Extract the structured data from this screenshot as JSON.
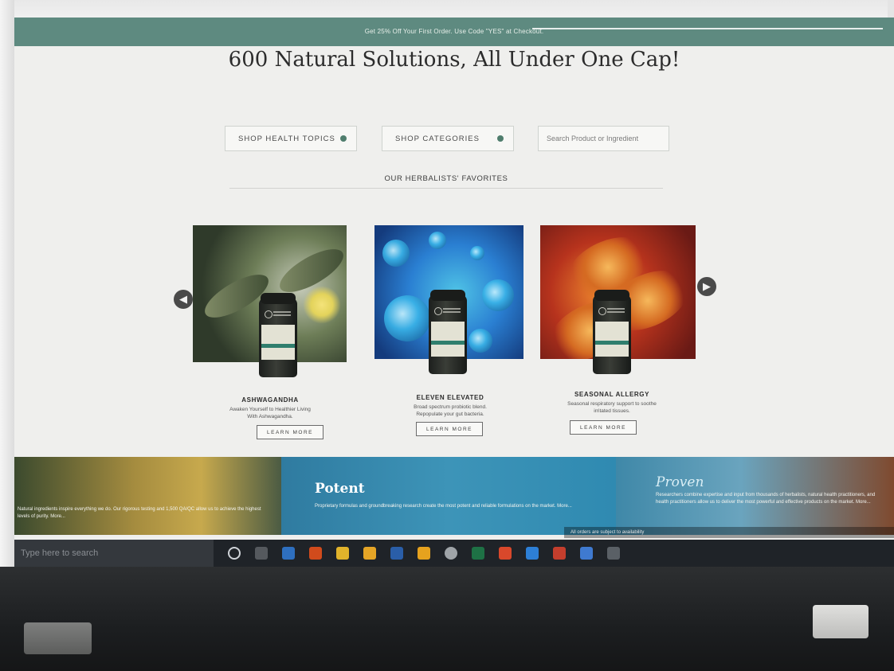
{
  "promo": {
    "text": "Get 25% Off Your First Order. Use Code \"YES\" at Checkout."
  },
  "headline": "600 Natural Solutions, All Under One Cap!",
  "nav": {
    "health_topics": "SHOP HEALTH TOPICS",
    "categories": "SHOP CATEGORIES",
    "search_placeholder": "Search Product or Ingredient"
  },
  "favorites": {
    "title": "OUR HERBALISTS' FAVORITES",
    "products": [
      {
        "name": "ASHWAGANDHA",
        "desc_line1": "Awaken Yourself to Healthier Living",
        "desc_line2": "With Ashwagandha.",
        "button": "LEARN MORE"
      },
      {
        "name": "ELEVEN ELEVATED",
        "desc_line1": "Broad spectrum probiotic blend.",
        "desc_line2": "Repopulate your gut bacteria.",
        "button": "LEARN MORE"
      },
      {
        "name": "SEASONAL ALLERGY",
        "desc_line1": "Seasonal respiratory support to soothe",
        "desc_line2": "irritated tissues.",
        "button": "LEARN MORE"
      }
    ]
  },
  "strips": {
    "left_text": "Natural ingredients inspire everything we do. Our rigorous testing and 1,500 QA/QC allow us to achieve the highest levels of purity. More...",
    "mid_title": "Potent",
    "mid_text": "Proprietary formulas and groundbreaking research create the most potent and reliable formulations on the market. More...",
    "right_title": "Proven",
    "right_text": "Researchers combine expertise and input from thousands of herbalists, natural health practitioners, and health practitioners allow us to deliver the most powerful and effective products on the market. More..."
  },
  "status": "All orders are subject to availability",
  "taskbar": {
    "search_placeholder": "Type here to search"
  },
  "colors": {
    "brand_green": "#5e8a80",
    "accent_dot": "#4f7d6d"
  }
}
